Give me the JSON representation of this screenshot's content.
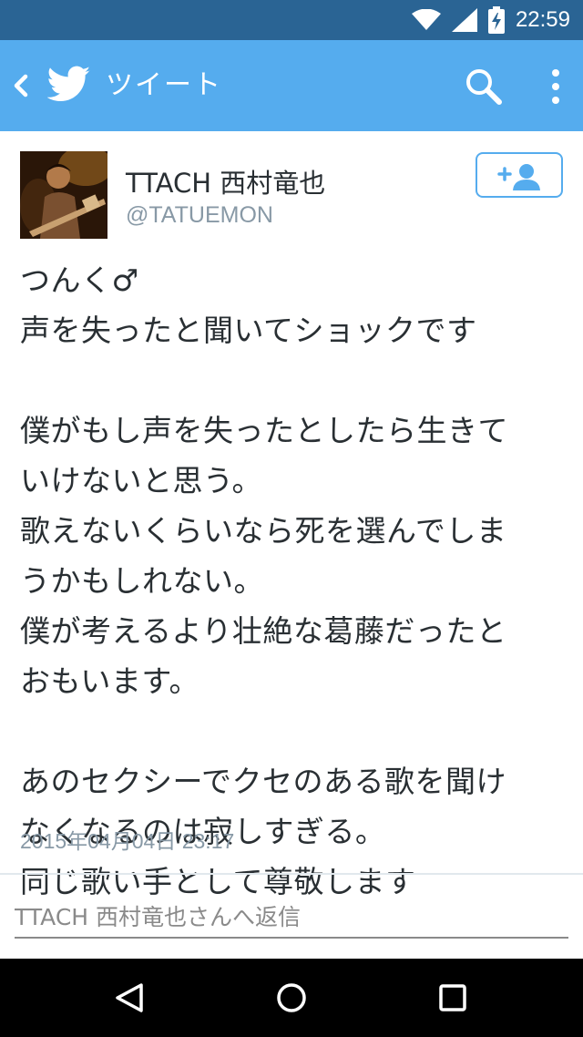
{
  "status_bar": {
    "time": "22:59",
    "icons": [
      "wifi-icon",
      "signal-icon",
      "battery-charging-icon"
    ]
  },
  "app_bar": {
    "title": "ツイート",
    "icons": [
      "back-arrow-icon",
      "twitter-bird-icon",
      "search-icon",
      "overflow-menu-icon"
    ],
    "color": "#55acee"
  },
  "tweet": {
    "display_name": "TTACH 西村竜也",
    "handle": "@TATUEMON",
    "follow_icon": "add-user-icon",
    "text": "つんく♂\n声を失ったと聞いてショックです\n\n僕がもし声を失ったとしたら生きて\nいけないと思う。\n歌えないくらいなら死を選んでしま\nうかもしれない。\n僕が考えるより壮絶な葛藤だったと\nおもいます。\n\nあのセクシーでクセのある歌を聞け\nなくなるのは寂しすぎる。\n同じ歌い手として尊敬します",
    "timestamp": "2015年04月04日 23:17"
  },
  "reply": {
    "placeholder": "TTACH 西村竜也さんへ返信"
  },
  "nav_bar": {
    "icons": [
      "back-triangle-icon",
      "home-circle-icon",
      "recents-square-icon"
    ]
  }
}
